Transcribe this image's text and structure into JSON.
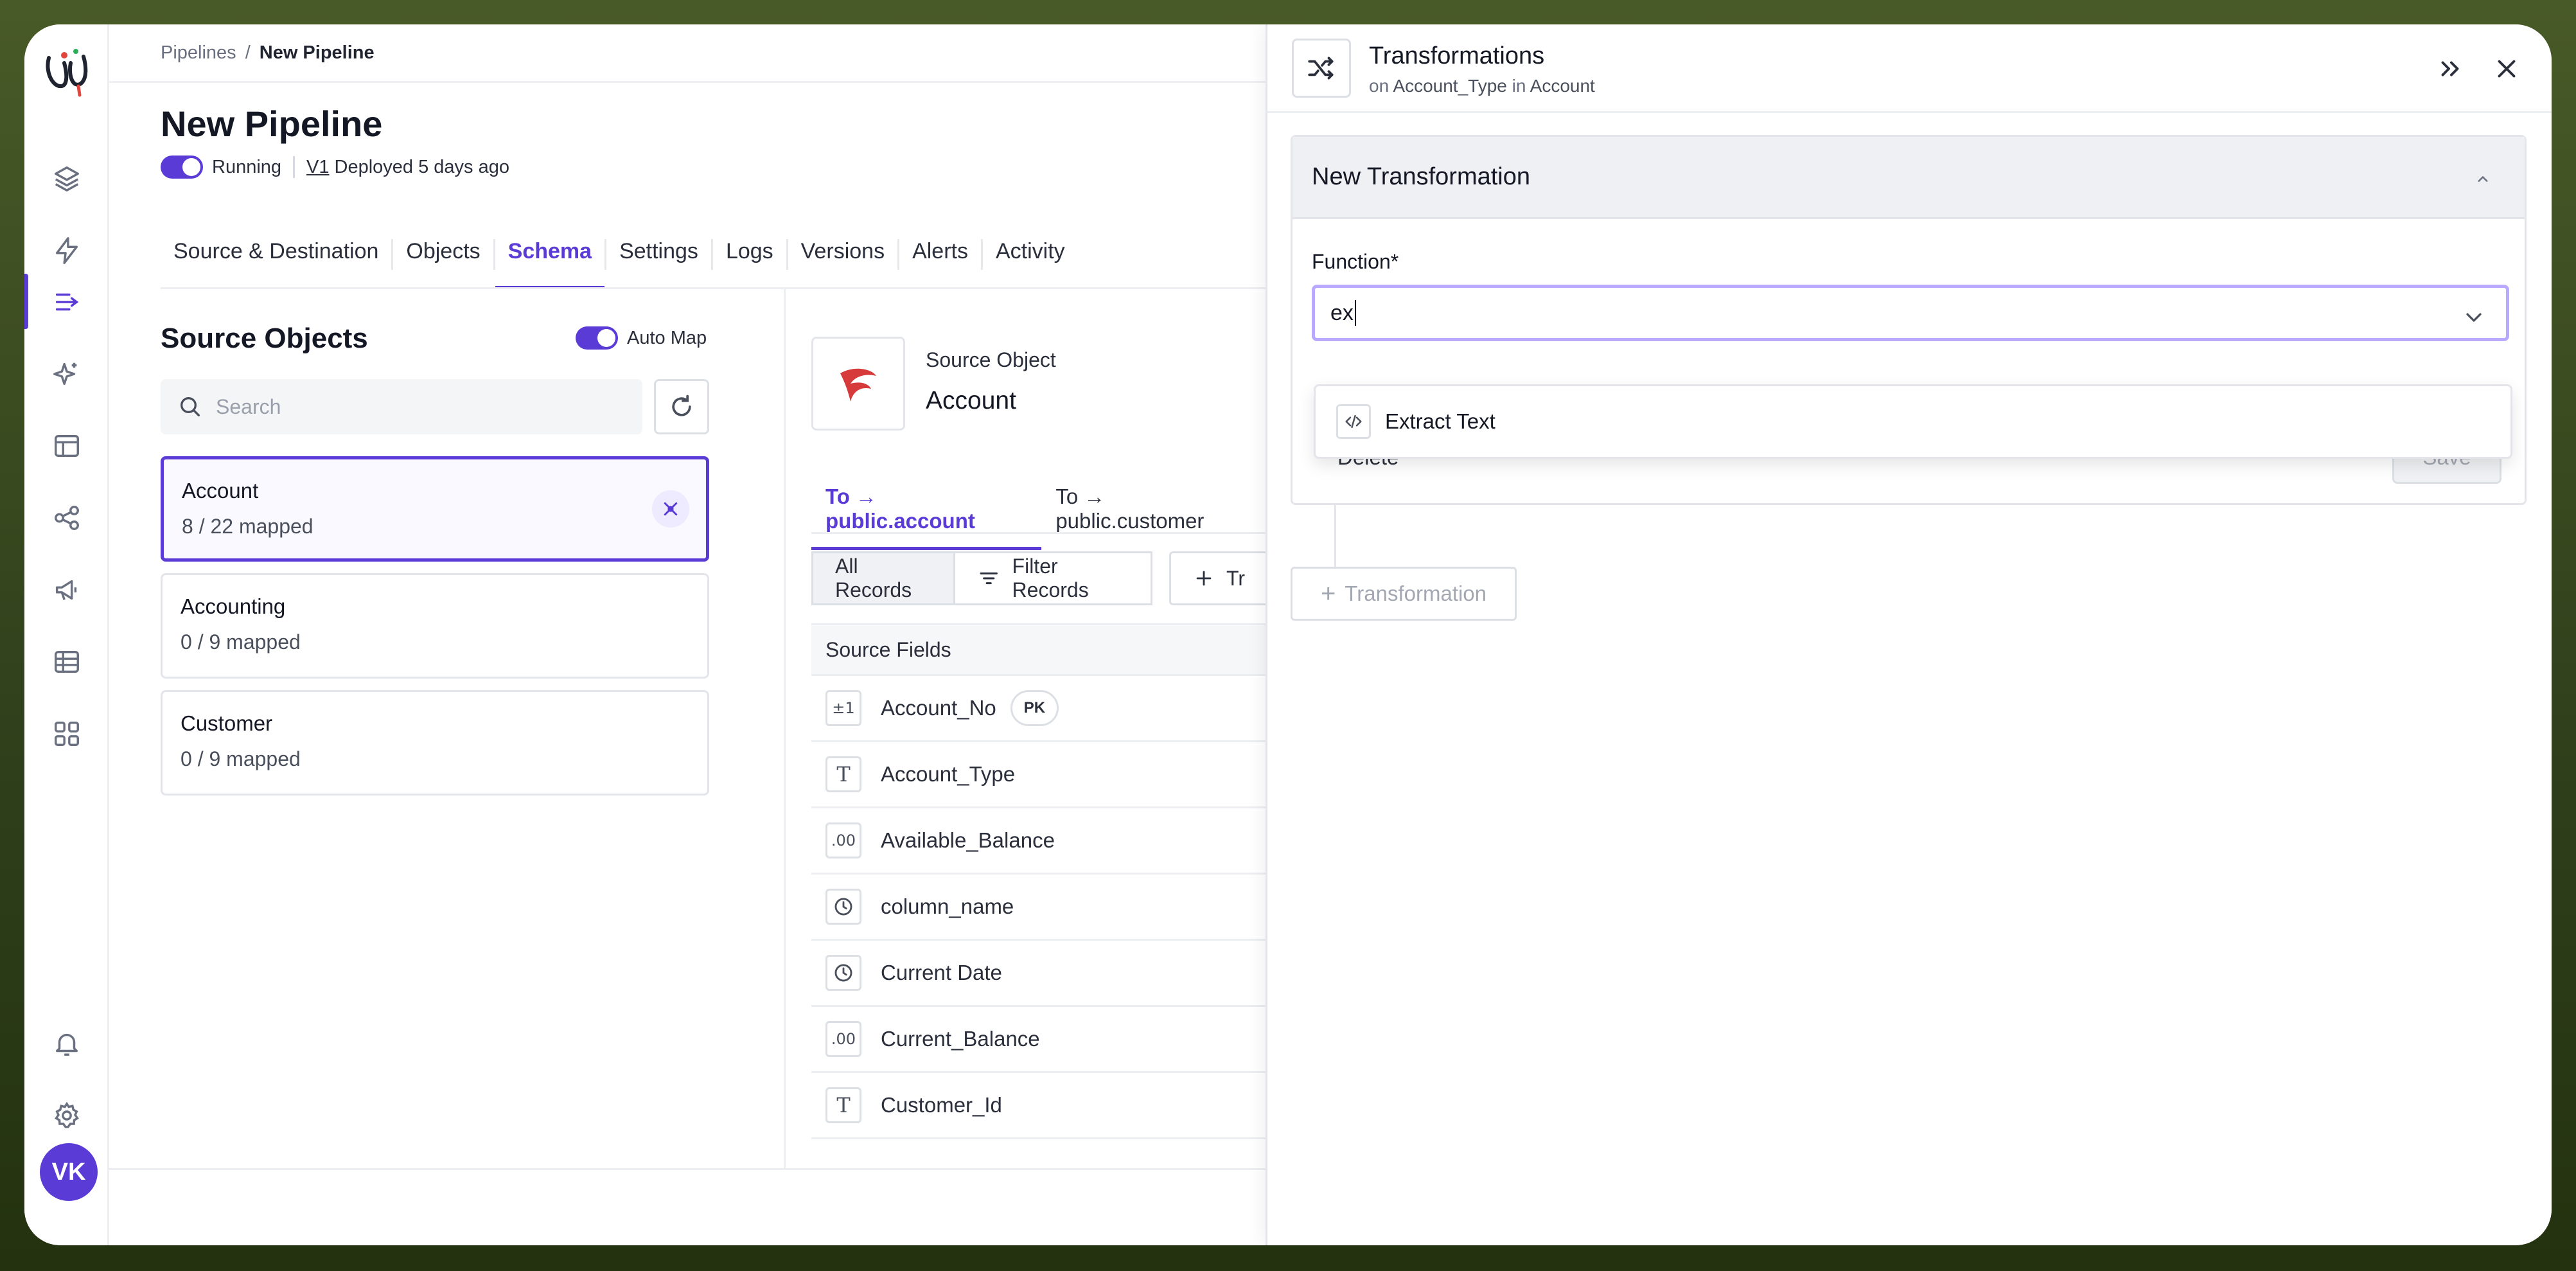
{
  "breadcrumb": {
    "root": "Pipelines",
    "separator": "/",
    "current": "New Pipeline"
  },
  "page": {
    "title": "New Pipeline",
    "status": "Running",
    "version": "V1",
    "deployed": "Deployed 5 days ago"
  },
  "tabs": [
    "Source & Destination",
    "Objects",
    "Schema",
    "Settings",
    "Logs",
    "Versions",
    "Alerts",
    "Activity"
  ],
  "active_tab": "Schema",
  "source_objects": {
    "title": "Source Objects",
    "auto_map_label": "Auto Map",
    "search_placeholder": "Search",
    "items": [
      {
        "name": "Account",
        "mapped": "8 / 22 mapped"
      },
      {
        "name": "Accounting",
        "mapped": "0 / 9 mapped"
      },
      {
        "name": "Customer",
        "mapped": "0 / 9 mapped"
      }
    ]
  },
  "source_object": {
    "label": "Source Object",
    "value": "Account",
    "sub_tabs": [
      "To → public.account",
      "To → public.customer"
    ],
    "buttons": {
      "all": "All Records",
      "filter": "Filter Records",
      "add": "Tr"
    },
    "fields_header": "Source Fields",
    "fields": [
      {
        "type": "±1",
        "name": "Account_No",
        "badge": "PK"
      },
      {
        "type": "T",
        "name": "Account_Type"
      },
      {
        "type": ".00",
        "name": "Available_Balance"
      },
      {
        "type": "clock",
        "name": "column_name"
      },
      {
        "type": "clock",
        "name": "Current Date"
      },
      {
        "type": ".00",
        "name": "Current_Balance"
      },
      {
        "type": "T",
        "name": "Customer_Id"
      }
    ]
  },
  "user": {
    "initials": "VK"
  },
  "panel": {
    "title": "Transformations",
    "subtitle_prefix": "on",
    "subtitle_field": "Account_Type",
    "subtitle_mid": "in",
    "subtitle_object": "Account",
    "card_title": "New Transformation",
    "function_label": "Function*",
    "function_value": "ex",
    "dropdown_option": "Extract Text",
    "delete_label": "Delete",
    "save_label": "Save",
    "add_label": "Transformation"
  },
  "colors": {
    "accent": "#5b3bd6",
    "background": "#485a27"
  }
}
